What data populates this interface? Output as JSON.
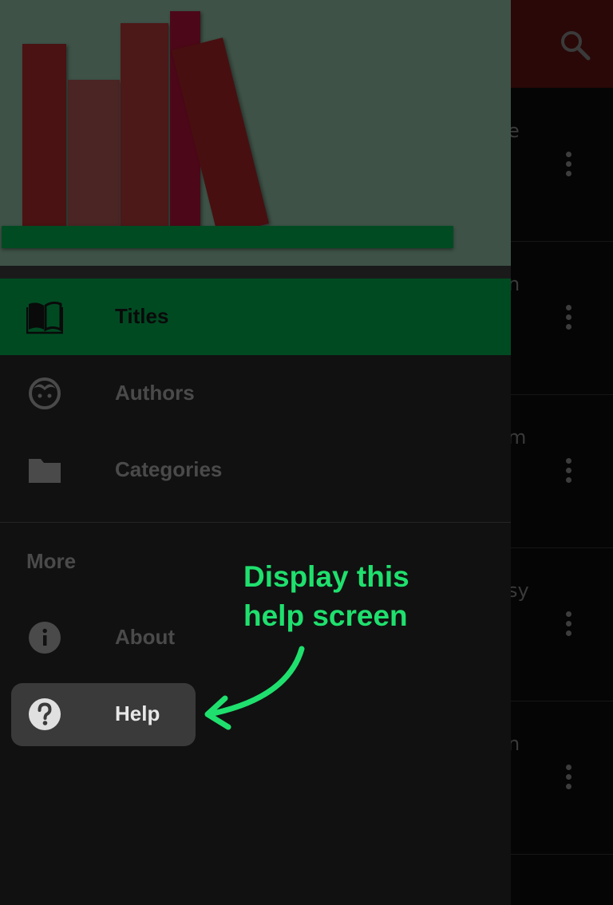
{
  "background_list": {
    "row_fragments": [
      "e",
      "n",
      "m",
      "sy",
      "n"
    ]
  },
  "drawer": {
    "nav_items": [
      {
        "label": "Titles",
        "icon": "book-open-icon",
        "active": true
      },
      {
        "label": "Authors",
        "icon": "face-icon",
        "active": false
      },
      {
        "label": "Categories",
        "icon": "folder-icon",
        "active": false
      }
    ],
    "section_label": "More",
    "more_items": [
      {
        "label": "About",
        "icon": "info-icon"
      },
      {
        "label": "Help",
        "icon": "help-icon",
        "highlighted": true
      }
    ]
  },
  "annotation": {
    "line1": "Display this",
    "line2": "help screen"
  },
  "colors": {
    "accent_green": "#004a22",
    "callout_green": "#1fe06e",
    "toolbar_dark_red": "#2a0808"
  }
}
